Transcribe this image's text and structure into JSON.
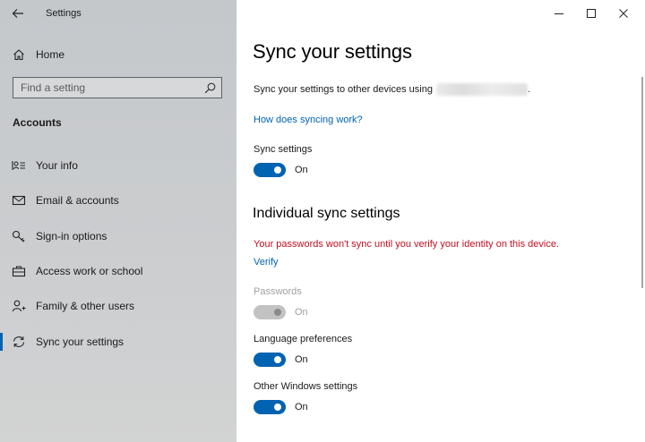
{
  "window": {
    "title": "Settings",
    "icons": {
      "back": "back-arrow-icon",
      "minimize": "minimize-icon",
      "maximize": "maximize-icon",
      "close": "close-icon"
    }
  },
  "sidebar": {
    "home_label": "Home",
    "search_placeholder": "Find a setting",
    "section_title": "Accounts",
    "items": [
      {
        "label": "Your info",
        "icon": "person-card-icon",
        "selected": false
      },
      {
        "label": "Email & accounts",
        "icon": "mail-icon",
        "selected": false
      },
      {
        "label": "Sign-in options",
        "icon": "key-icon",
        "selected": false
      },
      {
        "label": "Access work or school",
        "icon": "briefcase-icon",
        "selected": false
      },
      {
        "label": "Family & other users",
        "icon": "person-add-icon",
        "selected": false
      },
      {
        "label": "Sync your settings",
        "icon": "sync-icon",
        "selected": true
      }
    ]
  },
  "main": {
    "title": "Sync your settings",
    "description": "Sync your settings to other devices using",
    "description_suffix": ".",
    "how_link": "How does syncing work?",
    "sync_settings": {
      "label": "Sync settings",
      "state": "On",
      "on": true,
      "disabled": false
    },
    "individual_title": "Individual sync settings",
    "warning": "Your passwords won't sync until you verify your identity on this device.",
    "verify_link": "Verify",
    "toggles": [
      {
        "label": "Passwords",
        "state": "On",
        "on": true,
        "disabled": true
      },
      {
        "label": "Language preferences",
        "state": "On",
        "on": true,
        "disabled": false
      },
      {
        "label": "Other Windows settings",
        "state": "On",
        "on": true,
        "disabled": false
      }
    ]
  },
  "colors": {
    "accent": "#0063b1",
    "warning": "#c50f1f",
    "disabled_toggle": "#c2c2c2",
    "sidebar_bg": "#c9cbcd"
  }
}
